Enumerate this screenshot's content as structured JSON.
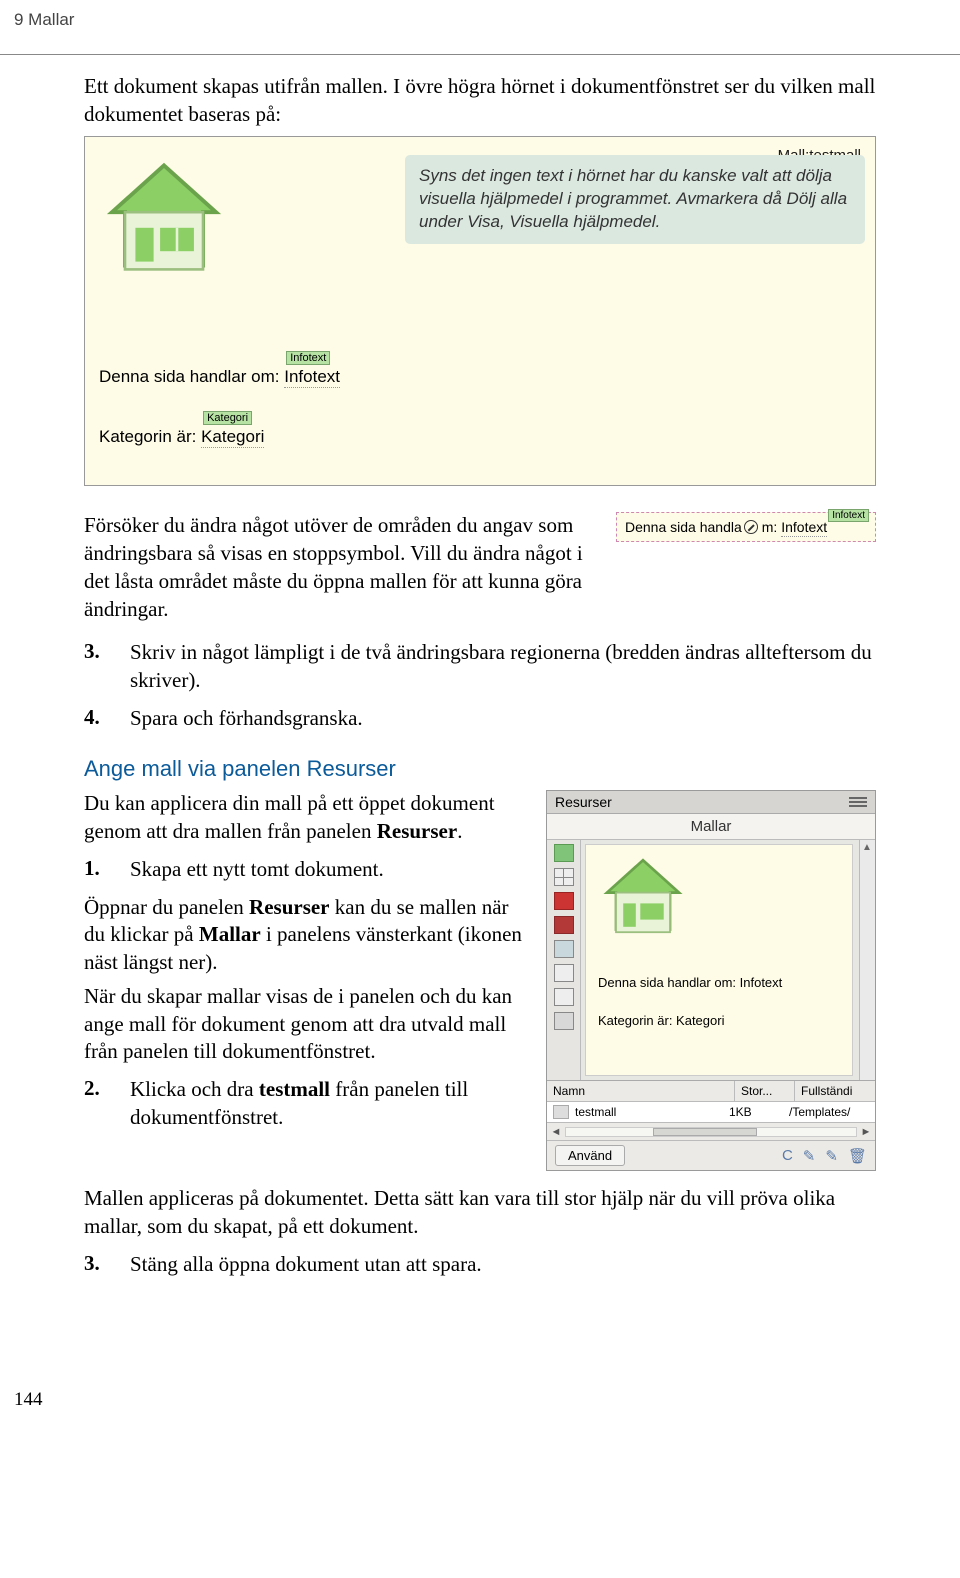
{
  "header": {
    "chapter": "9 Mallar"
  },
  "intro": {
    "p1": "Ett dokument skapas utifrån mallen. I övre högra hörnet i dokumentfönstret ser du vilken mall dokumentet baseras på:"
  },
  "doc_preview": {
    "mall_label": "Mall:testmall",
    "field1_label": "Denna sida handlar om: ",
    "field1_tag": "Infotext",
    "field1_value": "Infotext",
    "field2_label": "Kategorin är: ",
    "field2_tag": "Kategori",
    "field2_value": "Kategori"
  },
  "tip": {
    "text": "Syns det ingen text i hörnet har du kanske valt att dölja visuella hjälpmedel i programmet. Avmarkera då Dölj alla under Visa, Visuella hjälpmedel."
  },
  "para2": "Försöker du ändra något utöver de områden du angav som ändringsbara så visas en stoppsymbol. Vill du ändra något i det låsta området måste du öppna mallen för att kunna göra ändringar.",
  "snippet": {
    "label_prefix": "Denna sida handla",
    "label_suffix": "m: ",
    "tag": "Infotext",
    "value": "Infotext"
  },
  "list1": {
    "n3": "3.",
    "t3": "Skriv in något lämpligt i de två ändringsbara regionerna (bredden ändras allteftersom du skriver).",
    "n4": "4.",
    "t4": "Spara och förhandsgranska."
  },
  "section_title": "Ange mall via panelen Resurser",
  "resurser": {
    "p1a": "Du kan applicera din mall på ett öppet dokument genom att dra mallen från panelen ",
    "p1b": "Resurser",
    "p1c": ".",
    "l1n": "1.",
    "l1t": "Skapa ett nytt tomt dokument.",
    "p2a": "Öppnar du panelen ",
    "p2b": "Resurser",
    "p2c": " kan du se mallen när du klickar på ",
    "p2d": "Mallar",
    "p2e": " i panelens vänsterkant (ikonen näst längst ner).",
    "p3": "När du skapar mallar visas de i panelen och du kan ange mall för dokument genom att dra utvald mall från panelen till dokumentfönstret.",
    "l2n": "2.",
    "l2ta": "Klicka och dra ",
    "l2tb": "testmall",
    "l2tc": " från panelen till dokumentfönstret."
  },
  "panel": {
    "title": "Resurser",
    "tab": "Mallar",
    "preview_line1": "Denna sida handlar om: Infotext",
    "preview_line2": "Kategorin är: Kategori",
    "cols": {
      "name": "Namn",
      "size": "Stor...",
      "path": "Fullständi"
    },
    "row": {
      "name": "testmall",
      "size": "1KB",
      "path": "/Templates/"
    },
    "apply": "Använd"
  },
  "after": {
    "p1": "Mallen appliceras på dokumentet. Detta sätt kan vara till stor hjälp när du vill pröva olika mallar, som du skapat, på ett dokument.",
    "l3n": "3.",
    "l3t": "Stäng alla öppna dokument utan att spara."
  },
  "page_number": "144"
}
